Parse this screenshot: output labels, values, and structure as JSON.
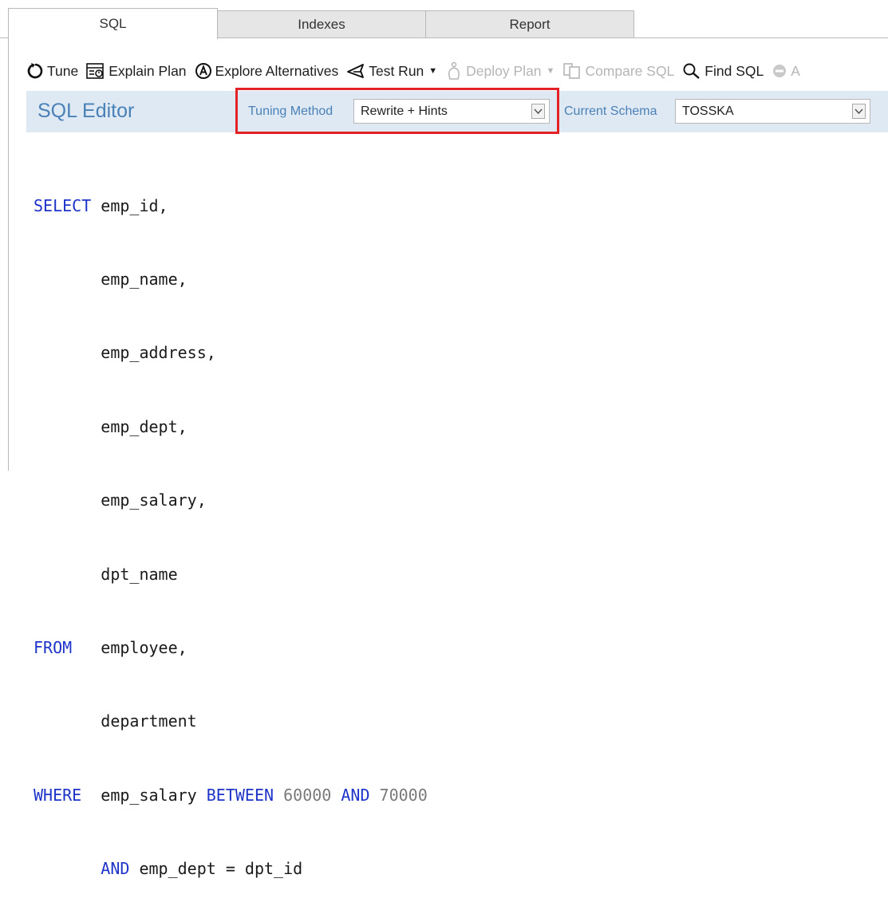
{
  "tabs": [
    {
      "label": "SQL",
      "active": true
    },
    {
      "label": "Indexes",
      "active": false
    },
    {
      "label": "Report",
      "active": false
    }
  ],
  "toolbar": {
    "tune": "Tune",
    "explain_plan": "Explain Plan",
    "explore_alternatives": "Explore Alternatives",
    "test_run": "Test Run",
    "deploy_plan": "Deploy Plan",
    "compare_sql": "Compare SQL",
    "find_sql": "Find SQL",
    "truncated": "A"
  },
  "editor": {
    "title": "SQL Editor",
    "tuning_method_label": "Tuning Method",
    "tuning_method_value": "Rewrite + Hints",
    "schema_label": "Current Schema",
    "schema_value": "TOSSKA"
  },
  "colors": {
    "keyword": "#1e34c8",
    "number": "#7a7a7a",
    "highlight": "#e32227",
    "header_bg": "#dfe9f4",
    "label": "#4a81b6"
  },
  "sql": {
    "l1": {
      "kw": "SELECT",
      "text": " emp_id,"
    },
    "l2": {
      "text": "       emp_name,"
    },
    "l3": {
      "text": "       emp_address,"
    },
    "l4": {
      "text": "       emp_dept,"
    },
    "l5": {
      "text": "       emp_salary,"
    },
    "l6": {
      "text": "       dpt_name"
    },
    "l7": {
      "kw": "FROM",
      "text": "   employee,"
    },
    "l8": {
      "text": "       department"
    },
    "l9": {
      "kw": "WHERE",
      "pre": "  emp_salary ",
      "kw2": "BETWEEN",
      "n1": "60000",
      "kw3": "AND",
      "n2": "70000"
    },
    "l10": {
      "indent": "       ",
      "kw": "AND",
      "text": " emp_dept = dpt_id"
    }
  }
}
